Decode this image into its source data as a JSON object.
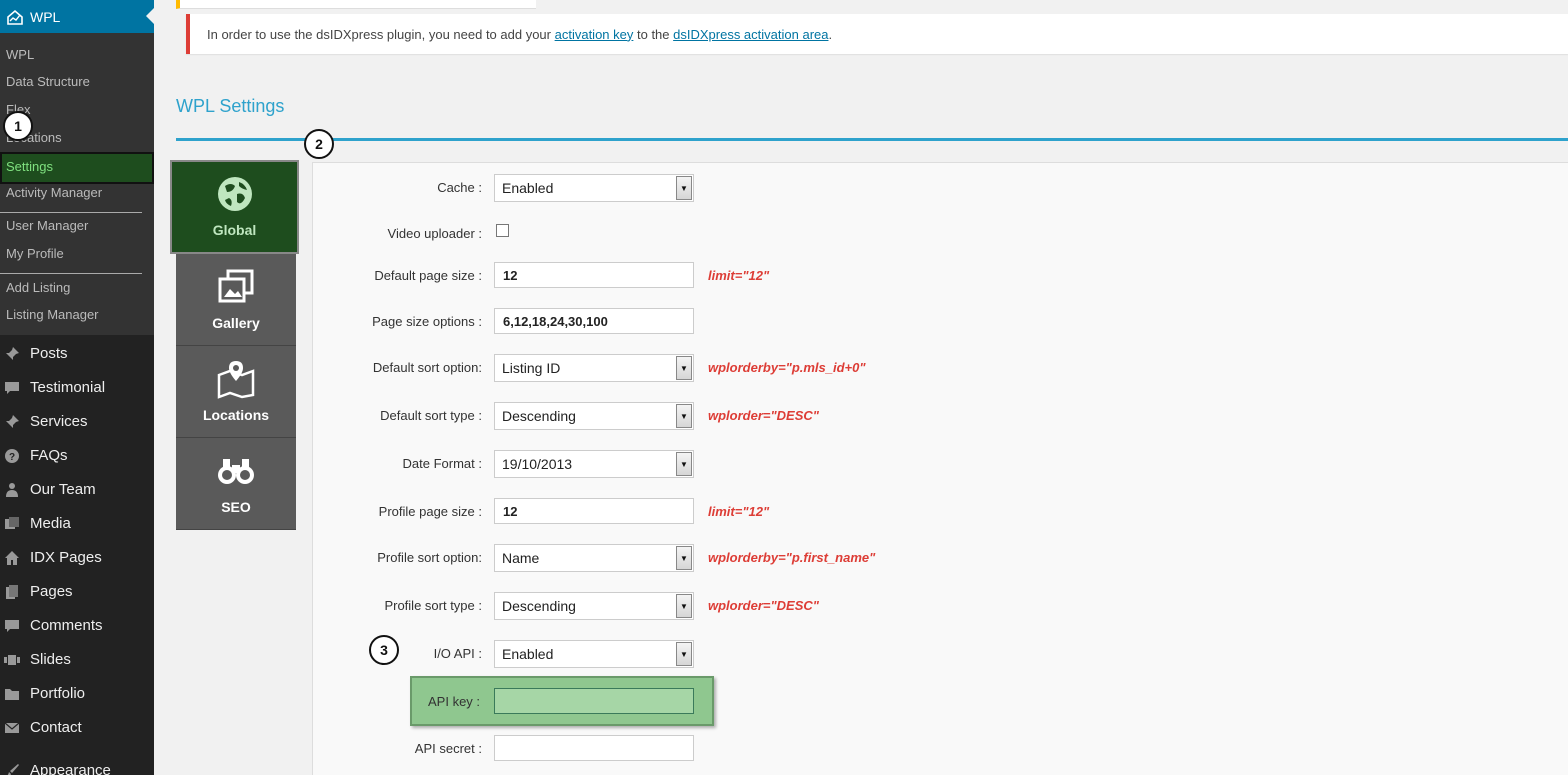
{
  "sidebar": {
    "top": "WPL",
    "submenu": [
      "WPL",
      "Data Structure",
      "Flex",
      "Locations",
      "Settings",
      "Activity Manager",
      "User Manager",
      "My Profile",
      "Add Listing",
      "Listing Manager"
    ],
    "menu": [
      {
        "label": "Posts",
        "icon": "pin-icon"
      },
      {
        "label": "Testimonial",
        "icon": "comment-icon"
      },
      {
        "label": "Services",
        "icon": "pin-icon"
      },
      {
        "label": "FAQs",
        "icon": "question-icon"
      },
      {
        "label": "Our Team",
        "icon": "user-icon"
      },
      {
        "label": "Media",
        "icon": "media-icon"
      },
      {
        "label": "IDX Pages",
        "icon": "home-icon"
      },
      {
        "label": "Pages",
        "icon": "pages-icon"
      },
      {
        "label": "Comments",
        "icon": "comment-icon"
      },
      {
        "label": "Slides",
        "icon": "slides-icon"
      },
      {
        "label": "Portfolio",
        "icon": "folder-icon"
      },
      {
        "label": "Contact",
        "icon": "mail-icon"
      },
      {
        "label": "Appearance",
        "icon": "brush-icon"
      }
    ]
  },
  "callouts": [
    "1",
    "2",
    "3"
  ],
  "notice": {
    "text_before": "In order to use the dsIDXpress plugin, you need to add your ",
    "link1": "activation key",
    "text_middle": " to the ",
    "link2": "dsIDXpress activation area",
    "text_after": "."
  },
  "settings": {
    "title": "WPL Settings",
    "tabs": [
      "Global",
      "Gallery",
      "Locations",
      "SEO"
    ],
    "active_tab": "Global",
    "fields": {
      "cache": {
        "label": "Cache :",
        "value": "Enabled"
      },
      "video_uploader": {
        "label": "Video uploader :",
        "checked": false
      },
      "default_page_size": {
        "label": "Default page size :",
        "value": "12",
        "note": "limit=\"12\""
      },
      "page_size_options": {
        "label": "Page size options :",
        "value": "6,12,18,24,30,100"
      },
      "default_sort_option": {
        "label": "Default sort option:",
        "value": "Listing ID",
        "note": "wplorderby=\"p.mls_id+0\""
      },
      "default_sort_type": {
        "label": "Default sort type :",
        "value": "Descending",
        "note": "wplorder=\"DESC\""
      },
      "date_format": {
        "label": "Date Format :",
        "value": "19/10/2013"
      },
      "profile_page_size": {
        "label": "Profile page size :",
        "value": "12",
        "note": "limit=\"12\""
      },
      "profile_sort_option": {
        "label": "Profile sort option:",
        "value": "Name",
        "note": "wplorderby=\"p.first_name\""
      },
      "profile_sort_type": {
        "label": "Profile sort type :",
        "value": "Descending",
        "note": "wplorder=\"DESC\""
      },
      "io_api": {
        "label": "I/O API :",
        "value": "Enabled"
      },
      "api_key": {
        "label": "API key :",
        "value": ""
      },
      "api_secret": {
        "label": "API secret :",
        "value": ""
      }
    }
  }
}
